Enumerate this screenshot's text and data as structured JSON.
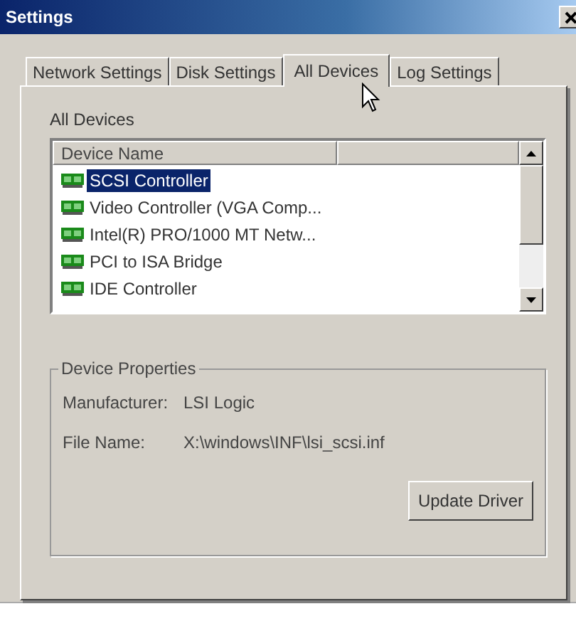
{
  "window": {
    "title": "Settings"
  },
  "tabs": [
    {
      "label": "Network Settings",
      "selected": false
    },
    {
      "label": "Disk Settings",
      "selected": false
    },
    {
      "label": "All Devices",
      "selected": true
    },
    {
      "label": "Log Settings",
      "selected": false
    }
  ],
  "list_label": "All Devices",
  "table": {
    "columns": [
      "Device Name"
    ],
    "rows": [
      {
        "name": "SCSI Controller",
        "selected": true
      },
      {
        "name": "Video Controller (VGA Comp...",
        "selected": false
      },
      {
        "name": "Intel(R) PRO/1000 MT Netw...",
        "selected": false
      },
      {
        "name": "PCI to ISA Bridge",
        "selected": false
      },
      {
        "name": "IDE Controller",
        "selected": false
      }
    ]
  },
  "device_properties": {
    "title": "Device Properties",
    "fields": [
      {
        "label": "Manufacturer:",
        "value": "LSI Logic"
      },
      {
        "label": "File Name:",
        "value": "X:\\windows\\INF\\lsi_scsi.inf"
      }
    ],
    "button": "Update Driver"
  }
}
